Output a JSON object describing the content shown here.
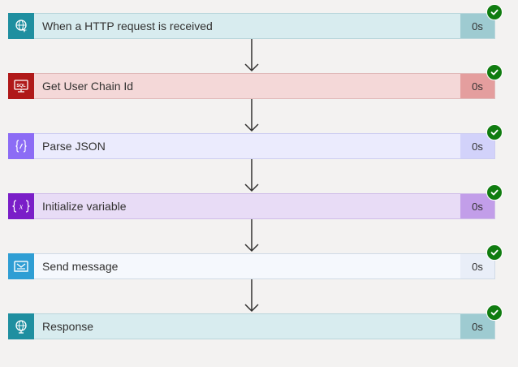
{
  "steps": [
    {
      "label": "When a HTTP request is received",
      "duration": "0s",
      "icon": "globe-request-icon",
      "status": "succeeded"
    },
    {
      "label": "Get User Chain Id",
      "duration": "0s",
      "icon": "sql-icon",
      "status": "succeeded"
    },
    {
      "label": "Parse JSON",
      "duration": "0s",
      "icon": "braces-icon",
      "status": "succeeded"
    },
    {
      "label": "Initialize variable",
      "duration": "0s",
      "icon": "variable-icon",
      "status": "succeeded"
    },
    {
      "label": "Send message",
      "duration": "0s",
      "icon": "message-queue-icon",
      "status": "succeeded"
    },
    {
      "label": "Response",
      "duration": "0s",
      "icon": "globe-response-icon",
      "status": "succeeded"
    }
  ],
  "colors": {
    "success": "#107c10",
    "http": "#1f8fa0",
    "sql": "#b01919",
    "parse_json": "#8c6cf5",
    "variable": "#7a1ec8",
    "service_bus": "#2f9ed4"
  }
}
